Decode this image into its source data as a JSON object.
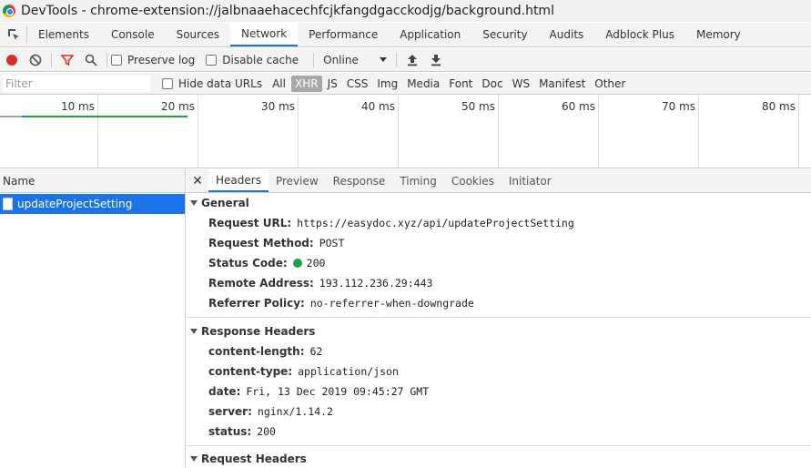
{
  "window": {
    "title": "DevTools - chrome-extension://jalbnaaehacechfcjkfangdgacckodjg/background.html"
  },
  "main_tabs": [
    "Elements",
    "Console",
    "Sources",
    "Network",
    "Performance",
    "Application",
    "Security",
    "Audits",
    "Adblock Plus",
    "Memory"
  ],
  "toolbar": {
    "preserve_log": "Preserve log",
    "disable_cache": "Disable cache",
    "throttling": "Online"
  },
  "filterbar": {
    "placeholder": "Filter",
    "hide_data_urls": "Hide data URLs",
    "types": [
      "All",
      "XHR",
      "JS",
      "CSS",
      "Img",
      "Media",
      "Font",
      "Doc",
      "WS",
      "Manifest",
      "Other"
    ]
  },
  "timeline": {
    "ticks": [
      "10 ms",
      "20 ms",
      "30 ms",
      "40 ms",
      "50 ms",
      "60 ms",
      "70 ms",
      "80 ms"
    ]
  },
  "request_list": {
    "header": "Name",
    "rows": [
      "updateProjectSetting"
    ]
  },
  "detail_tabs": [
    "Headers",
    "Preview",
    "Response",
    "Timing",
    "Cookies",
    "Initiator"
  ],
  "general": {
    "title": "General",
    "request_url_label": "Request URL:",
    "request_url": "https://easydoc.xyz/api/updateProjectSetting",
    "request_method_label": "Request Method:",
    "request_method": "POST",
    "status_code_label": "Status Code:",
    "status_code": "200",
    "remote_address_label": "Remote Address:",
    "remote_address": "193.112.236.29:443",
    "referrer_policy_label": "Referrer Policy:",
    "referrer_policy": "no-referrer-when-downgrade"
  },
  "response_headers": {
    "title": "Response Headers",
    "items": [
      {
        "key": "content-length:",
        "value": "62"
      },
      {
        "key": "content-type:",
        "value": "application/json"
      },
      {
        "key": "date:",
        "value": "Fri, 13 Dec 2019 09:45:27 GMT"
      },
      {
        "key": "server:",
        "value": "nginx/1.14.2"
      },
      {
        "key": "status:",
        "value": "200"
      }
    ]
  },
  "request_headers": {
    "title": "Request Headers"
  },
  "colors": {
    "accent": "#1a73e8",
    "record": "#d93025",
    "status_ok": "#1e9e4a"
  }
}
